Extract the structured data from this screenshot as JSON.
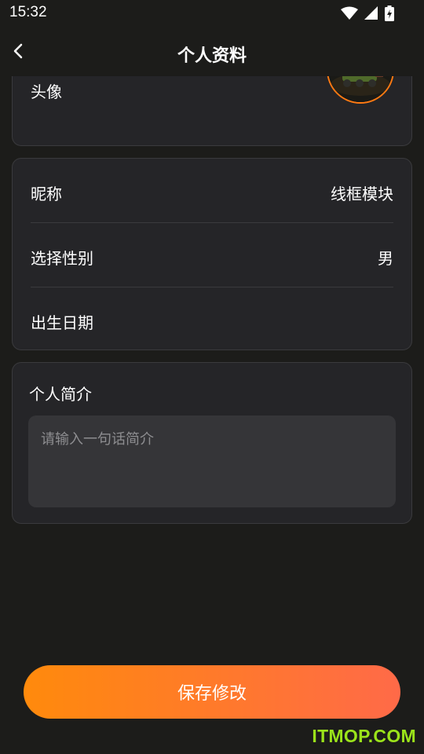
{
  "status_bar": {
    "time": "15:32"
  },
  "nav": {
    "title": "个人资料"
  },
  "avatar_card": {
    "label": "头像"
  },
  "info_card": {
    "nickname_label": "昵称",
    "nickname_value": "线框模块",
    "gender_label": "选择性别",
    "gender_value": "男",
    "birthday_label": "出生日期"
  },
  "intro_card": {
    "label": "个人简介",
    "placeholder": "请输入一句话简介"
  },
  "save_button": {
    "label": "保存修改"
  },
  "watermark": {
    "text": "ITMOP.COM"
  },
  "colors": {
    "accent": "#ff7a12",
    "background": "#1c1c1a",
    "card": "#252528",
    "watermark": "#9be31a"
  }
}
